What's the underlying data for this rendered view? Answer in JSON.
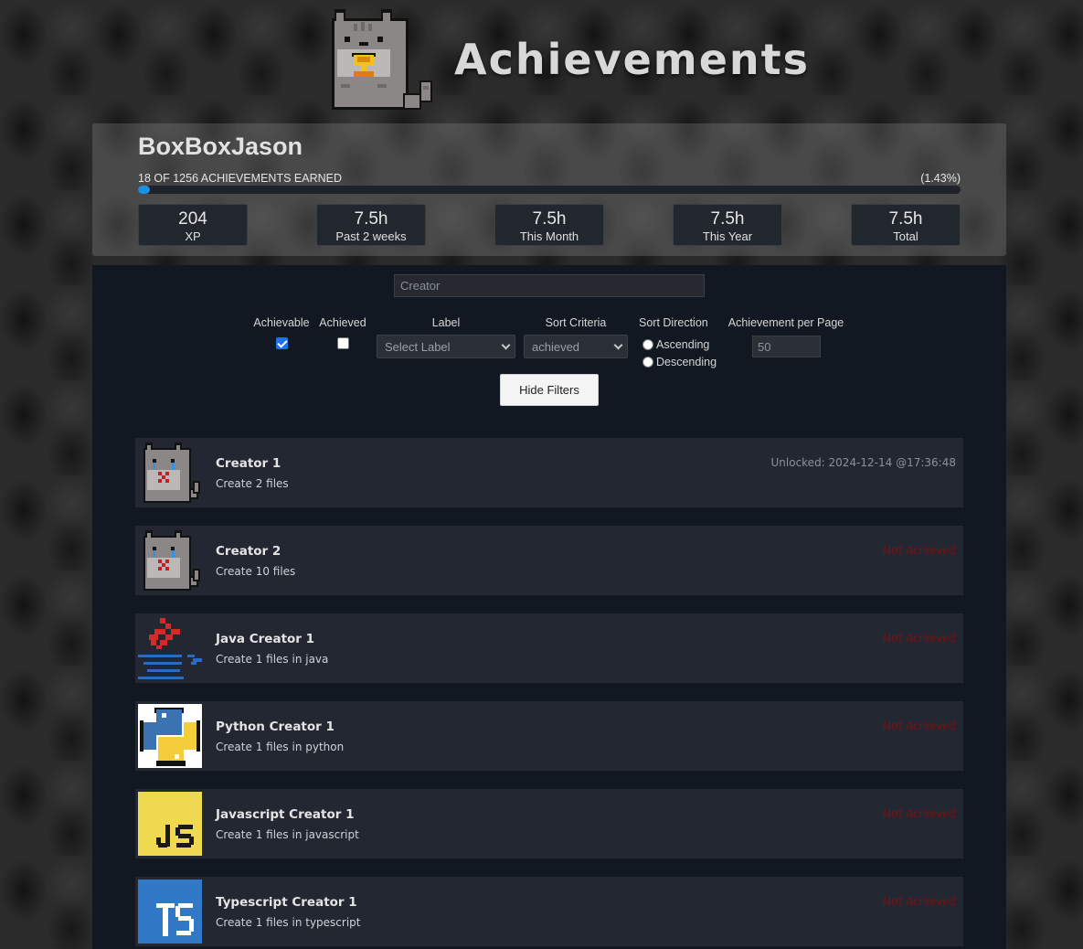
{
  "header": {
    "title": "Achievements",
    "logo_icon": "cat-trophy-icon"
  },
  "profile": {
    "username": "BoxBoxJason",
    "earned_text": "18 OF 1256 ACHIEVEMENTS EARNED",
    "percent_text": "(1.43%)",
    "progress_fraction": 0.0143,
    "accent_color": "#1d8fe0",
    "stats": [
      {
        "value": "204",
        "label": "XP"
      },
      {
        "value": "7.5h",
        "label": "Past 2 weeks"
      },
      {
        "value": "7.5h",
        "label": "This Month"
      },
      {
        "value": "7.5h",
        "label": "This Year"
      },
      {
        "value": "7.5h",
        "label": "Total"
      }
    ]
  },
  "filters": {
    "search_value": "",
    "search_placeholder": "Creator",
    "achievable_label": "Achievable",
    "achievable_checked": true,
    "achieved_label": "Achieved",
    "achieved_checked": false,
    "label_header": "Label",
    "label_select_value": "Select Label",
    "sort_criteria_header": "Sort Criteria",
    "sort_criteria_value": "achieved",
    "sort_direction_header": "Sort Direction",
    "ascending_label": "Ascending",
    "descending_label": "Descending",
    "per_page_header": "Achievement per Page",
    "per_page_value": "50",
    "hide_filters_label": "Hide Filters"
  },
  "achievements": [
    {
      "title": "Creator 1",
      "description": "Create 2 files",
      "status": "Unlocked: 2024-12-14 @17:36:48",
      "unlocked": true,
      "icon": "crying-cat-icon"
    },
    {
      "title": "Creator 2",
      "description": "Create 10 files",
      "status": "Not Achieved",
      "unlocked": false,
      "icon": "crying-cat-icon"
    },
    {
      "title": "Java Creator 1",
      "description": "Create 1 files in java",
      "status": "Not Achieved",
      "unlocked": false,
      "icon": "java-icon"
    },
    {
      "title": "Python Creator 1",
      "description": "Create 1 files in python",
      "status": "Not Achieved",
      "unlocked": false,
      "icon": "python-icon"
    },
    {
      "title": "Javascript Creator 1",
      "description": "Create 1 files in javascript",
      "status": "Not Achieved",
      "unlocked": false,
      "icon": "javascript-icon"
    },
    {
      "title": "Typescript Creator 1",
      "description": "Create 1 files in typescript",
      "status": "Not Achieved",
      "unlocked": false,
      "icon": "typescript-icon"
    }
  ]
}
